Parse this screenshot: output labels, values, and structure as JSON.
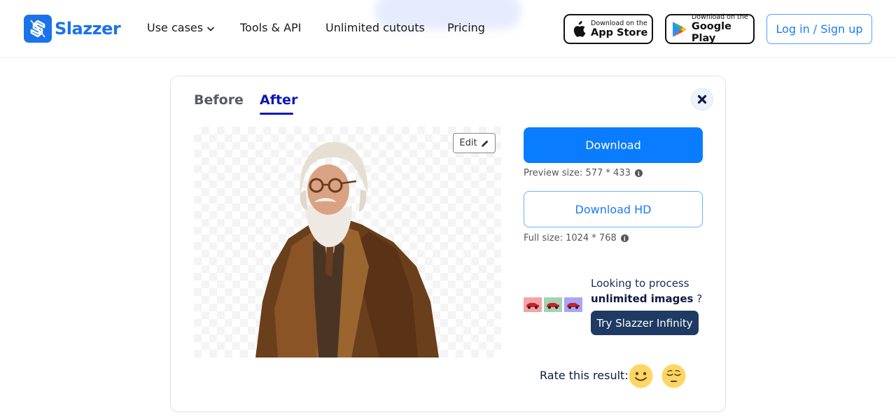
{
  "header": {
    "brand": "Slazzer",
    "nav": [
      {
        "label": "Use cases",
        "has_dropdown": true
      },
      {
        "label": "Tools & API"
      },
      {
        "label": "Unlimited cutouts"
      },
      {
        "label": "Pricing"
      }
    ],
    "app_store": {
      "small": "Download on the",
      "big": "App Store",
      "icon": "apple-icon"
    },
    "google_play": {
      "small": "Download on the",
      "big": "Google Play",
      "icon": "google-play-icon"
    },
    "login_label": "Log in / Sign up"
  },
  "result_card": {
    "tabs": [
      {
        "label": "Before",
        "active": false
      },
      {
        "label": "After",
        "active": true
      }
    ],
    "close_icon": "close-icon",
    "edit_label": "Edit",
    "preview_image": "Elderly man with white beard, round glasses and brown fur coat (background removed)",
    "download_label": "Download",
    "preview_size": "Preview size: 577 * 433",
    "download_hd_label": "Download HD",
    "full_size": "Full size: 1024 * 768",
    "promo": {
      "line1": "Looking to process",
      "line2_bold": "unlimited images",
      "line2_rest": " ?",
      "button_label": "Try Slazzer Infinity",
      "thumb_colors": [
        "#f4a3a3",
        "#a6d1b4",
        "#a8a6f7"
      ]
    },
    "rate_label": "Rate this result:",
    "rating_options": [
      "happy-face",
      "disappointed-face"
    ]
  },
  "colors": {
    "brand": "#1a73e8",
    "primary_button": "#0a7cff",
    "active_tab": "#0b17b8",
    "infinity_button": "#1f3a63"
  }
}
